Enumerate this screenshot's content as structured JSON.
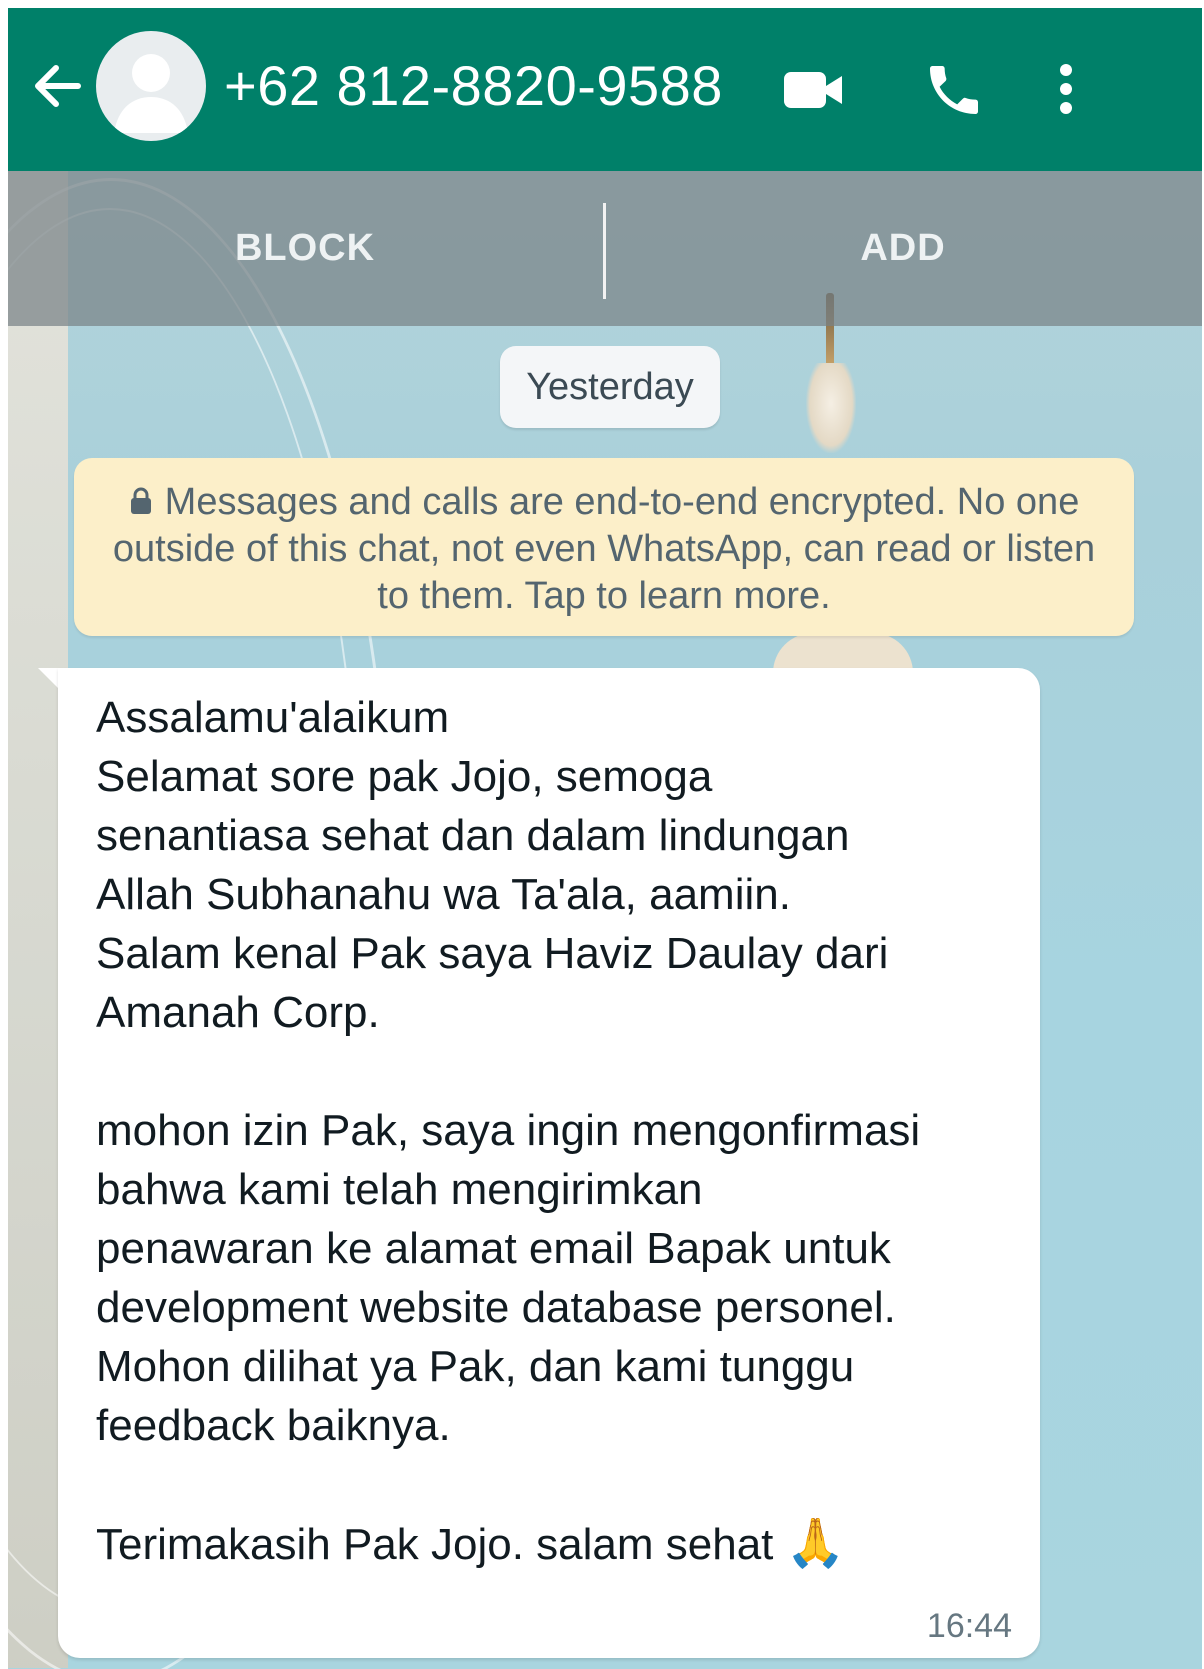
{
  "header": {
    "contact_number": "+62 812-8820-9588",
    "icons": {
      "back": "arrow-left-icon",
      "avatar": "default-avatar-icon",
      "video": "video-camera-icon",
      "call": "phone-icon",
      "menu": "more-vertical-icon"
    },
    "color": "#008069"
  },
  "actions": {
    "block_label": "BLOCK",
    "add_label": "ADD"
  },
  "chat": {
    "date_chip": "Yesterday",
    "encryption_notice": {
      "text": "Messages and calls are end-to-end encrypted. No one outside of this chat, not even WhatsApp, can read or listen to them. Tap to learn more.",
      "icon": "lock-icon",
      "background": "#fcefc9"
    },
    "messages": [
      {
        "direction": "incoming",
        "text": "Assalamu'alaikum\nSelamat sore pak Jojo, semoga\nsenantiasa sehat dan dalam lindungan\nAllah Subhanahu wa Ta'ala, aamiin.\nSalam kenal Pak saya Haviz Daulay dari\nAmanah Corp.\n\nmohon izin Pak, saya ingin mengonfirmasi\nbahwa kami telah mengirimkan\npenawaran ke alamat email Bapak untuk\ndevelopment website database personel.\nMohon dilihat ya Pak, dan kami tunggu\nfeedback baiknya.\n\nTerimakasih Pak Jojo. salam sehat",
        "emoji": "🙏",
        "time": "16:44"
      }
    ]
  }
}
